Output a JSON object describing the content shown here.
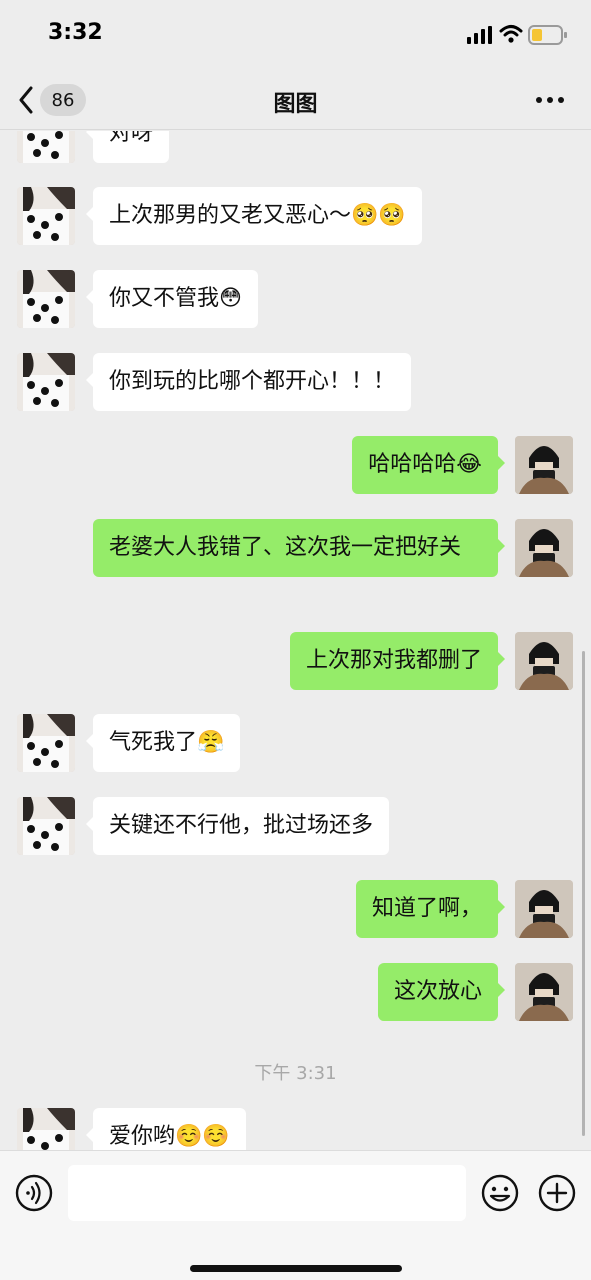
{
  "status_bar": {
    "time": "3:32",
    "battery_color": "#f5c534"
  },
  "header": {
    "unread_count": "86",
    "title": "图图"
  },
  "messages": [
    {
      "side": "left",
      "text": "对呀"
    },
    {
      "side": "left",
      "text": "上次那男的又老又恶心～🥺🥺"
    },
    {
      "side": "left",
      "text": "你又不管我😳"
    },
    {
      "side": "left",
      "text": "你到玩的比哪个都开心！！！"
    },
    {
      "side": "right",
      "text": "哈哈哈哈😂"
    },
    {
      "side": "right",
      "text": "老婆大人我错了、这次我一定把好关"
    },
    {
      "side": "right",
      "text": "上次那对我都删了"
    },
    {
      "side": "left",
      "text": "气死我了😤"
    },
    {
      "side": "left",
      "text": "关键还不行他，批过场还多"
    },
    {
      "side": "right",
      "text": "知道了啊，"
    },
    {
      "side": "right",
      "text": "这次放心"
    },
    {
      "side": "left",
      "text": "爱你哟☺️☺️"
    }
  ],
  "time_divider": "下午 3:31",
  "input": {
    "value": "",
    "placeholder": ""
  },
  "colors": {
    "self_bubble": "#95ec69",
    "other_bubble": "#ffffff",
    "background": "#ededed"
  },
  "icons": {
    "back": "chevron-left-icon",
    "more": "more-dots-icon",
    "voice": "voice-icon",
    "emoji": "emoji-icon",
    "add": "plus-icon"
  }
}
